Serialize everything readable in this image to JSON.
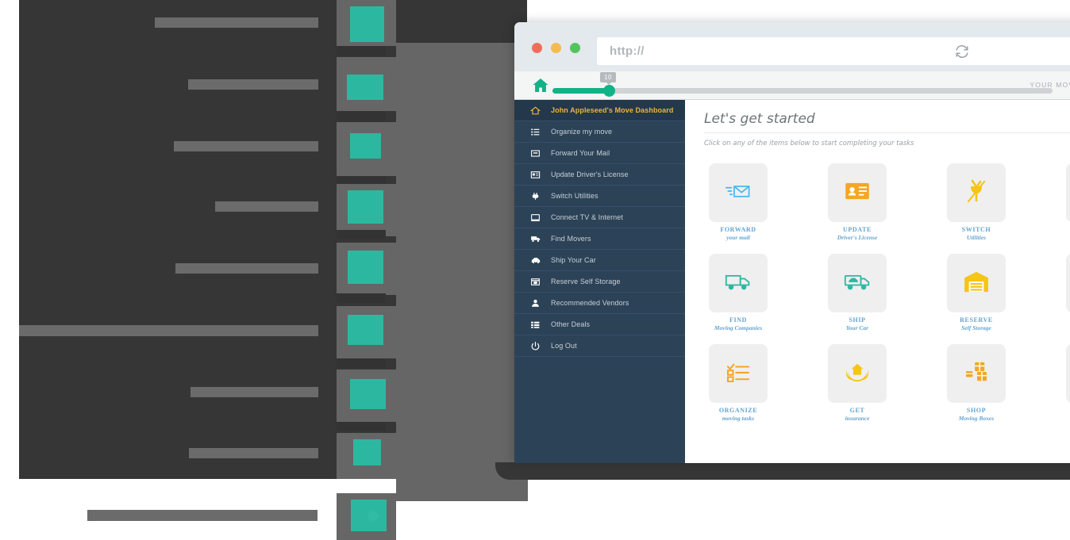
{
  "browser": {
    "url_placeholder": "http://",
    "reload_icon": "refresh-icon",
    "traffic_lights": [
      "close-red",
      "minimize-amber",
      "maximize-green"
    ]
  },
  "app_header": {
    "home_icon": "home-icon",
    "progress_badge": "10",
    "moving_day_label": "YOUR MOVING DAY"
  },
  "sidebar": {
    "items": [
      {
        "label": "John Appleseed's Move Dashboard",
        "icon": "home-outline-icon",
        "active": true
      },
      {
        "label": "Organize my move",
        "icon": "list-icon",
        "active": false
      },
      {
        "label": "Forward Your Mail",
        "icon": "envelope-icon",
        "active": false
      },
      {
        "label": "Update Driver's License",
        "icon": "id-card-icon",
        "active": false
      },
      {
        "label": "Switch Utilities",
        "icon": "plug-icon",
        "active": false
      },
      {
        "label": "Connect TV & Internet",
        "icon": "monitor-icon",
        "active": false
      },
      {
        "label": "Find Movers",
        "icon": "truck-icon",
        "active": false
      },
      {
        "label": "Ship Your Car",
        "icon": "car-icon",
        "active": false
      },
      {
        "label": "Reserve Self Storage",
        "icon": "storage-box-icon",
        "active": false
      },
      {
        "label": "Recommended Vendors",
        "icon": "person-icon",
        "active": false
      },
      {
        "label": "Other Deals",
        "icon": "grid-list-icon",
        "active": false
      },
      {
        "label": "Log Out",
        "icon": "power-icon",
        "active": false
      }
    ]
  },
  "main": {
    "title": "Let's get started",
    "subtitle": "Click on any of the items below to start completing your tasks",
    "cards": [
      {
        "title": "FORWARD",
        "sub": "your mail",
        "icon": "flying-envelope-icon",
        "color": "#4ab6ea"
      },
      {
        "title": "UPDATE",
        "sub": "Driver's License",
        "icon": "id-card-icon",
        "color": "#f5a623"
      },
      {
        "title": "SWITCH",
        "sub": "Utilities",
        "icon": "plug-icon",
        "color": "#f5c518"
      },
      {
        "title": "",
        "sub": "",
        "icon": "",
        "color": "#cccccc"
      },
      {
        "title": "FIND",
        "sub": "Moving Companies",
        "icon": "moving-truck-icon",
        "color": "#2cb8a0"
      },
      {
        "title": "SHIP",
        "sub": "Your Car",
        "icon": "car-carrier-icon",
        "color": "#2cb8a0"
      },
      {
        "title": "RESERVE",
        "sub": "Self Storage",
        "icon": "warehouse-icon",
        "color": "#f5c518"
      },
      {
        "title": "",
        "sub": "",
        "icon": "",
        "color": "#cccccc"
      },
      {
        "title": "ORGANIZE",
        "sub": "moving tasks",
        "icon": "checklist-icon",
        "color": "#f5a623"
      },
      {
        "title": "GET",
        "sub": "insurance",
        "icon": "house-in-hands-icon",
        "color": "#f5c518"
      },
      {
        "title": "SHOP",
        "sub": "Moving Boxes",
        "icon": "boxes-icon",
        "color": "#f5a623"
      },
      {
        "title": "",
        "sub": "",
        "icon": "",
        "color": "#cccccc"
      }
    ]
  },
  "colors": {
    "accent_teal": "#2cb8a0",
    "sidebar_bg": "#2c4257",
    "active_gold": "#e8b53b",
    "progress_green": "#12b287",
    "card_label_blue": "#63a3cf"
  }
}
